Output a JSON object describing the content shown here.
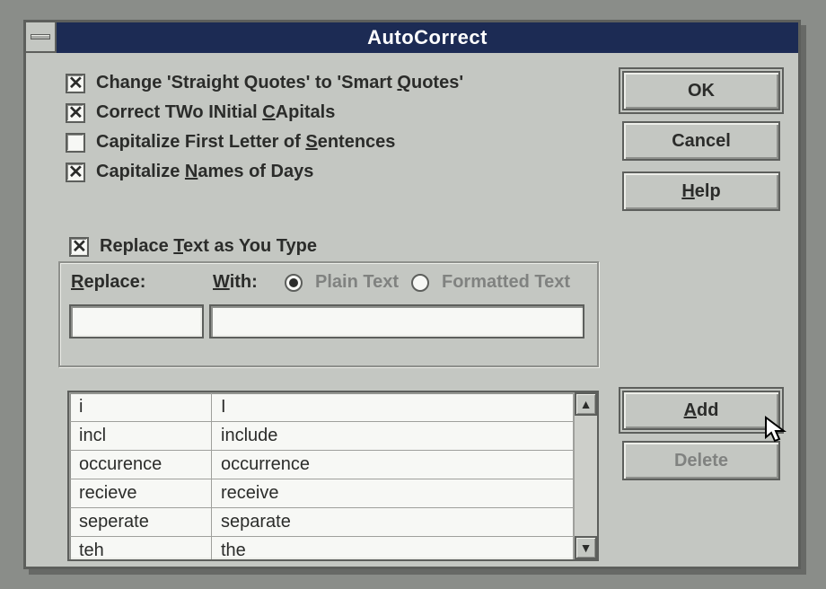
{
  "title": "AutoCorrect",
  "checkboxes": {
    "smart_quotes": {
      "checked": true,
      "pre": "Change 'Straight Quotes' to 'Smart ",
      "mn": "Q",
      "post": "uotes'"
    },
    "two_initial": {
      "checked": true,
      "pre": "Correct TWo INitial ",
      "mn": "C",
      "post": "Apitals"
    },
    "capitalize_sent": {
      "checked": false,
      "pre": "Capitalize First Letter of ",
      "mn": "S",
      "post": "entences"
    },
    "capitalize_days": {
      "checked": true,
      "pre": "Capitalize ",
      "mn": "N",
      "post": "ames of Days"
    },
    "replace_as_type": {
      "checked": true,
      "pre": "Replace ",
      "mn": "T",
      "post": "ext as You Type"
    }
  },
  "buttons": {
    "ok": "OK",
    "cancel": "Cancel",
    "help_pre": "",
    "help_mn": "H",
    "help_post": "elp",
    "add_pre": "",
    "add_mn": "A",
    "add_post": "dd",
    "delete": "Delete"
  },
  "replace_section": {
    "replace_label_pre": "",
    "replace_label_mn": "R",
    "replace_label_post": "eplace:",
    "with_label_pre": "",
    "with_label_mn": "W",
    "with_label_post": "ith:",
    "radio_plain": "Plain Text",
    "radio_formatted": "Formatted Text",
    "radio_selected": "plain",
    "replace_value": "",
    "with_value": ""
  },
  "entries": [
    {
      "replace": "i",
      "with": "I"
    },
    {
      "replace": "incl",
      "with": "include"
    },
    {
      "replace": "occurence",
      "with": "occurrence"
    },
    {
      "replace": "recieve",
      "with": "receive"
    },
    {
      "replace": "seperate",
      "with": "separate"
    },
    {
      "replace": "teh",
      "with": "the"
    }
  ]
}
